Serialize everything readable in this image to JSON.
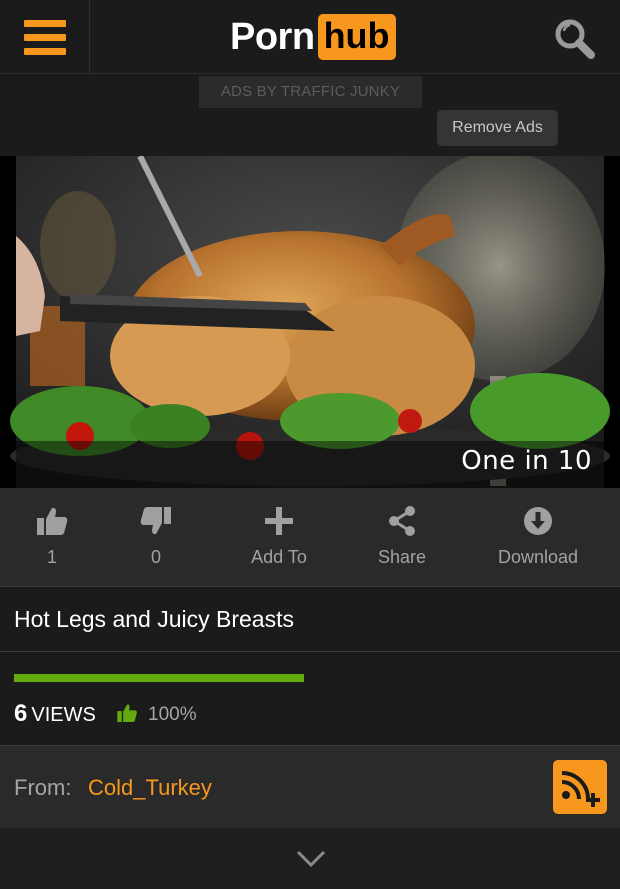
{
  "header": {
    "logo_text_left": "Porn",
    "logo_text_right": "hub",
    "brand_color": "#f7971d",
    "menu_icon": "hamburger-menu-icon",
    "search_icon": "search-icon"
  },
  "ads": {
    "label": "ADS BY TRAFFIC JUNKY",
    "remove_label": "Remove Ads"
  },
  "video": {
    "caption": "One in 10"
  },
  "actions": [
    {
      "id": "like",
      "icon": "thumbs-up-icon",
      "label": "1"
    },
    {
      "id": "dislike",
      "icon": "thumbs-down-icon",
      "label": "0"
    },
    {
      "id": "add-to",
      "icon": "plus-icon",
      "label": "Add To"
    },
    {
      "id": "share",
      "icon": "share-icon",
      "label": "Share"
    },
    {
      "id": "download",
      "icon": "download-icon",
      "label": "Download"
    }
  ],
  "video_info": {
    "title": "Hot Legs and Juicy Breasts",
    "rating_fraction": 1.0,
    "rating_color": "#63a910",
    "views_count": "6",
    "views_label": "VIEWS",
    "rating_percent": "100%"
  },
  "uploader": {
    "from_label": "From:",
    "name": "Cold_Turkey",
    "subscribe_icon": "rss-subscribe-icon"
  },
  "expand": {
    "icon": "chevron-down-icon"
  }
}
